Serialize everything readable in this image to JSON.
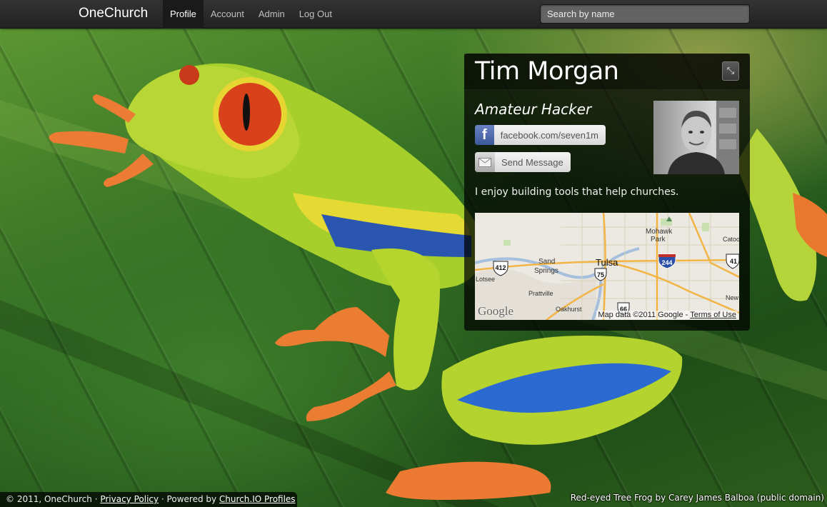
{
  "navbar": {
    "brand": "OneChurch",
    "items": [
      {
        "label": "Profile",
        "active": true
      },
      {
        "label": "Account",
        "active": false
      },
      {
        "label": "Admin",
        "active": false
      },
      {
        "label": "Log Out",
        "active": false
      }
    ],
    "search_placeholder": "Search by name"
  },
  "profile": {
    "name": "Tim Morgan",
    "edit_icon": "resize-icon",
    "tagline": "Amateur Hacker",
    "facebook": {
      "icon": "facebook-icon",
      "label": "facebook.com/seven1m"
    },
    "message": {
      "icon": "envelope-icon",
      "label": "Send Message"
    },
    "bio": "I enjoy building tools that help churches."
  },
  "map": {
    "labels": {
      "city": "Tulsa",
      "sand_springs_1": "Sand",
      "sand_springs_2": "Springs",
      "mohawk_1": "Mohawk",
      "mohawk_2": "Park",
      "prattville": "Prattville",
      "lotsee": "Lotsee",
      "oakhurst": "Oakhurst",
      "catoosa": "Catoo",
      "new": "New"
    },
    "shields": {
      "us412": "412",
      "us75": "75",
      "i244": "244",
      "us66": "66",
      "us41": "41"
    },
    "logo": "Google",
    "attribution_prefix": "Map data ©2011 Google - ",
    "attribution_link": "Terms of Use"
  },
  "footer": {
    "copyright": "© 2011, OneChurch · ",
    "privacy": "Privacy Policy",
    "separator": " · Powered by ",
    "powered_link": "Church.IO Profiles"
  },
  "photo_credit": "Red-eyed Tree Frog by Carey James Balboa (public domain)",
  "colors": {
    "navbar": "#222222",
    "card": "#000000",
    "facebook": "#3b5998"
  }
}
